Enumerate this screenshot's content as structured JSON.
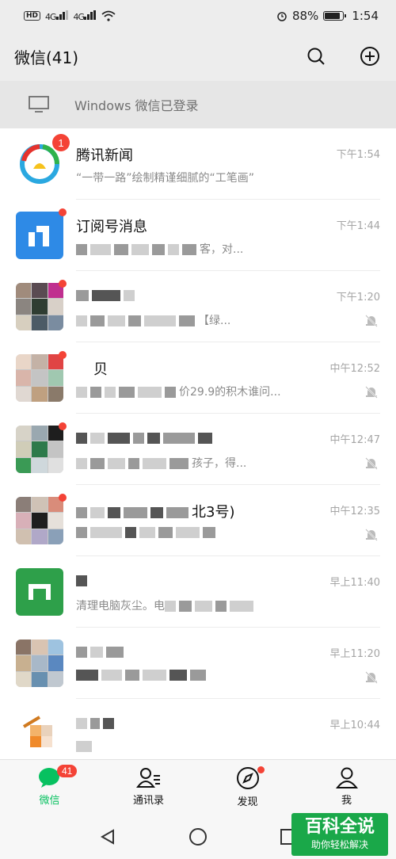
{
  "status_bar": {
    "left": [
      "HD",
      "4G",
      "4G"
    ],
    "battery_percent": "88%",
    "battery_level": 0.88,
    "time": "1:54"
  },
  "header": {
    "title": "微信(41)",
    "icons": [
      "search-icon",
      "add-icon"
    ]
  },
  "login_banner": {
    "text": "Windows 微信已登录",
    "icon": "desktop-icon"
  },
  "chats": [
    {
      "name": "腾讯新闻",
      "preview": "“一带一路”绘制精谨细腻的“工笔画”",
      "time": "下午1:54",
      "badge": "1",
      "muted": false
    },
    {
      "name": "订阅号消息",
      "preview": "客，对...",
      "time": "下午1:44",
      "dot": true,
      "muted": false
    },
    {
      "name": "",
      "preview": "【绿...",
      "time": "下午1:20",
      "dot": true,
      "muted": true
    },
    {
      "name": "贝",
      "preview": "价29.9的积木谁问...",
      "time": "中午12:52",
      "dot": true,
      "muted": true
    },
    {
      "name": "",
      "preview": "孩子，得...",
      "time": "中午12:47",
      "dot": true,
      "muted": true
    },
    {
      "name": "北3号)",
      "preview": "",
      "time": "中午12:35",
      "dot": true,
      "muted": true
    },
    {
      "name": "",
      "preview": "清理电脑灰尘。电",
      "time": "早上11:40",
      "muted": false
    },
    {
      "name": "",
      "preview": "",
      "time": "早上11:20",
      "muted": true
    },
    {
      "name": "",
      "preview": "",
      "time": "早上10:44",
      "muted": false
    }
  ],
  "tabs": [
    {
      "label": "微信",
      "icon": "chat-icon",
      "badge": "41",
      "active": true
    },
    {
      "label": "通讯录",
      "icon": "contacts-icon"
    },
    {
      "label": "发现",
      "icon": "compass-icon",
      "dot": true
    },
    {
      "label": "我",
      "icon": "profile-icon"
    }
  ],
  "watermark": {
    "line1": "百科全说",
    "line2": "助你轻松解决"
  },
  "colors": {
    "accent": "#07c160",
    "badge": "#f44336"
  }
}
